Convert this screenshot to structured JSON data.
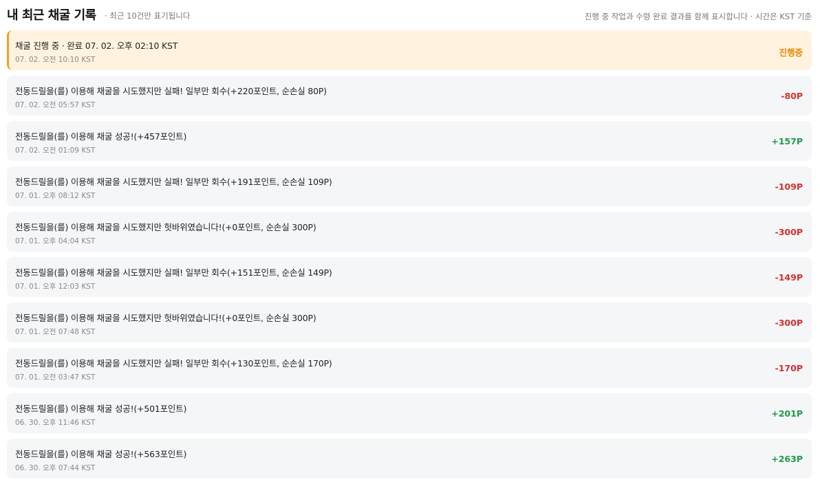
{
  "header": {
    "title": "내 최근 채굴 기록",
    "subtitle": "· 최근 10건만 표기됩니다",
    "note": "진행 중 작업과 수령 완료 결과를 함께 표시합니다 · 시간은 KST 기준"
  },
  "colors": {
    "pending": "#e58a00",
    "negative": "#d62f2f",
    "positive": "#1f9a4a",
    "active_bg": "#fff3e0",
    "active_border": "#f0a020",
    "row_bg": "#f5f6f8"
  },
  "records": [
    {
      "text": "채굴 진행 중 · 완료 07. 02. 오후 02:10 KST",
      "time": "07. 02. 오전 10:10 KST",
      "value": "진행중",
      "status": "pending"
    },
    {
      "text": "전동드릴을(를) 이용해 채굴을 시도했지만 실패! 일부만 회수(+220포인트, 순손실 80P)",
      "time": "07. 02. 오전 05:57 KST",
      "value": "-80P",
      "status": "negative"
    },
    {
      "text": "전동드릴을(를) 이용해 채굴 성공!(+457포인트)",
      "time": "07. 02. 오전 01:09 KST",
      "value": "+157P",
      "status": "positive"
    },
    {
      "text": "전동드릴을(를) 이용해 채굴을 시도했지만 실패! 일부만 회수(+191포인트, 순손실 109P)",
      "time": "07. 01. 오후 08:12 KST",
      "value": "-109P",
      "status": "negative"
    },
    {
      "text": "전동드릴을(를) 이용해 채굴을 시도했지만 헛바위였습니다!(+0포인트, 순손실 300P)",
      "time": "07. 01. 오후 04:04 KST",
      "value": "-300P",
      "status": "negative"
    },
    {
      "text": "전동드릴을(를) 이용해 채굴을 시도했지만 실패! 일부만 회수(+151포인트, 순손실 149P)",
      "time": "07. 01. 오후 12:03 KST",
      "value": "-149P",
      "status": "negative"
    },
    {
      "text": "전동드릴을(를) 이용해 채굴을 시도했지만 헛바위였습니다!(+0포인트, 순손실 300P)",
      "time": "07. 01. 오전 07:48 KST",
      "value": "-300P",
      "status": "negative"
    },
    {
      "text": "전동드릴을(를) 이용해 채굴을 시도했지만 실패! 일부만 회수(+130포인트, 순손실 170P)",
      "time": "07. 01. 오전 03:47 KST",
      "value": "-170P",
      "status": "negative"
    },
    {
      "text": "전동드릴을(를) 이용해 채굴 성공!(+501포인트)",
      "time": "06. 30. 오후 11:46 KST",
      "value": "+201P",
      "status": "positive"
    },
    {
      "text": "전동드릴을(를) 이용해 채굴 성공!(+563포인트)",
      "time": "06. 30. 오후 07:44 KST",
      "value": "+263P",
      "status": "positive"
    }
  ]
}
